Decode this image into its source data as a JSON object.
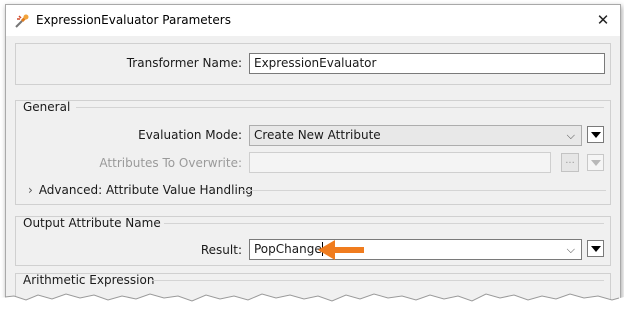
{
  "window": {
    "title": "ExpressionEvaluator Parameters",
    "close_glyph": "✕",
    "icon": "fme-transformer-icon"
  },
  "transformer_name": {
    "label": "Transformer Name:",
    "value": "ExpressionEvaluator"
  },
  "general": {
    "title": "General",
    "evaluation_mode": {
      "label": "Evaluation Mode:",
      "value": "Create New Attribute"
    },
    "attributes_to_overwrite": {
      "label": "Attributes To Overwrite:",
      "value": "",
      "ellipsis": "..."
    },
    "advanced": {
      "label": "Advanced: Attribute Value Handling",
      "arrow": "›"
    }
  },
  "output": {
    "title": "Output Attribute Name",
    "result_label": "Result:",
    "result_value": "PopChange",
    "annotation_arrow_color": "#f07c1e"
  },
  "arithmetic": {
    "title": "Arithmetic Expression"
  },
  "colors": {
    "window_bg": "#f0f0f0",
    "accent_arrow": "#f07c1e"
  }
}
